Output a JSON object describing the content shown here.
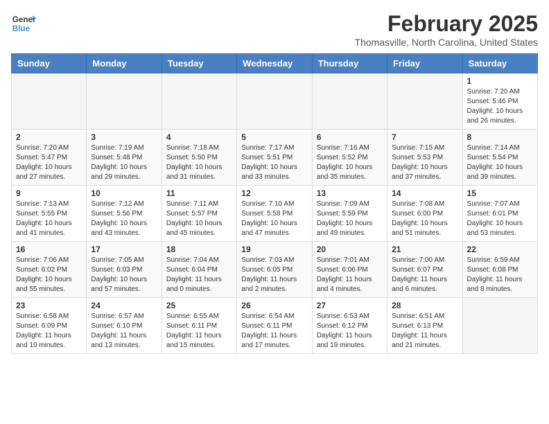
{
  "header": {
    "logo_line1": "General",
    "logo_line2": "Blue",
    "month_year": "February 2025",
    "location": "Thomasville, North Carolina, United States"
  },
  "days_of_week": [
    "Sunday",
    "Monday",
    "Tuesday",
    "Wednesday",
    "Thursday",
    "Friday",
    "Saturday"
  ],
  "weeks": [
    [
      {
        "day": "",
        "info": ""
      },
      {
        "day": "",
        "info": ""
      },
      {
        "day": "",
        "info": ""
      },
      {
        "day": "",
        "info": ""
      },
      {
        "day": "",
        "info": ""
      },
      {
        "day": "",
        "info": ""
      },
      {
        "day": "1",
        "info": "Sunrise: 7:20 AM\nSunset: 5:46 PM\nDaylight: 10 hours and 26 minutes."
      }
    ],
    [
      {
        "day": "2",
        "info": "Sunrise: 7:20 AM\nSunset: 5:47 PM\nDaylight: 10 hours and 27 minutes."
      },
      {
        "day": "3",
        "info": "Sunrise: 7:19 AM\nSunset: 5:48 PM\nDaylight: 10 hours and 29 minutes."
      },
      {
        "day": "4",
        "info": "Sunrise: 7:18 AM\nSunset: 5:50 PM\nDaylight: 10 hours and 31 minutes."
      },
      {
        "day": "5",
        "info": "Sunrise: 7:17 AM\nSunset: 5:51 PM\nDaylight: 10 hours and 33 minutes."
      },
      {
        "day": "6",
        "info": "Sunrise: 7:16 AM\nSunset: 5:52 PM\nDaylight: 10 hours and 35 minutes."
      },
      {
        "day": "7",
        "info": "Sunrise: 7:15 AM\nSunset: 5:53 PM\nDaylight: 10 hours and 37 minutes."
      },
      {
        "day": "8",
        "info": "Sunrise: 7:14 AM\nSunset: 5:54 PM\nDaylight: 10 hours and 39 minutes."
      }
    ],
    [
      {
        "day": "9",
        "info": "Sunrise: 7:13 AM\nSunset: 5:55 PM\nDaylight: 10 hours and 41 minutes."
      },
      {
        "day": "10",
        "info": "Sunrise: 7:12 AM\nSunset: 5:56 PM\nDaylight: 10 hours and 43 minutes."
      },
      {
        "day": "11",
        "info": "Sunrise: 7:11 AM\nSunset: 5:57 PM\nDaylight: 10 hours and 45 minutes."
      },
      {
        "day": "12",
        "info": "Sunrise: 7:10 AM\nSunset: 5:58 PM\nDaylight: 10 hours and 47 minutes."
      },
      {
        "day": "13",
        "info": "Sunrise: 7:09 AM\nSunset: 5:59 PM\nDaylight: 10 hours and 49 minutes."
      },
      {
        "day": "14",
        "info": "Sunrise: 7:08 AM\nSunset: 6:00 PM\nDaylight: 10 hours and 51 minutes."
      },
      {
        "day": "15",
        "info": "Sunrise: 7:07 AM\nSunset: 6:01 PM\nDaylight: 10 hours and 53 minutes."
      }
    ],
    [
      {
        "day": "16",
        "info": "Sunrise: 7:06 AM\nSunset: 6:02 PM\nDaylight: 10 hours and 55 minutes."
      },
      {
        "day": "17",
        "info": "Sunrise: 7:05 AM\nSunset: 6:03 PM\nDaylight: 10 hours and 57 minutes."
      },
      {
        "day": "18",
        "info": "Sunrise: 7:04 AM\nSunset: 6:04 PM\nDaylight: 11 hours and 0 minutes."
      },
      {
        "day": "19",
        "info": "Sunrise: 7:03 AM\nSunset: 6:05 PM\nDaylight: 11 hours and 2 minutes."
      },
      {
        "day": "20",
        "info": "Sunrise: 7:01 AM\nSunset: 6:06 PM\nDaylight: 11 hours and 4 minutes."
      },
      {
        "day": "21",
        "info": "Sunrise: 7:00 AM\nSunset: 6:07 PM\nDaylight: 11 hours and 6 minutes."
      },
      {
        "day": "22",
        "info": "Sunrise: 6:59 AM\nSunset: 6:08 PM\nDaylight: 11 hours and 8 minutes."
      }
    ],
    [
      {
        "day": "23",
        "info": "Sunrise: 6:58 AM\nSunset: 6:09 PM\nDaylight: 11 hours and 10 minutes."
      },
      {
        "day": "24",
        "info": "Sunrise: 6:57 AM\nSunset: 6:10 PM\nDaylight: 11 hours and 13 minutes."
      },
      {
        "day": "25",
        "info": "Sunrise: 6:55 AM\nSunset: 6:11 PM\nDaylight: 11 hours and 15 minutes."
      },
      {
        "day": "26",
        "info": "Sunrise: 6:54 AM\nSunset: 6:11 PM\nDaylight: 11 hours and 17 minutes."
      },
      {
        "day": "27",
        "info": "Sunrise: 6:53 AM\nSunset: 6:12 PM\nDaylight: 11 hours and 19 minutes."
      },
      {
        "day": "28",
        "info": "Sunrise: 6:51 AM\nSunset: 6:13 PM\nDaylight: 11 hours and 21 minutes."
      },
      {
        "day": "",
        "info": ""
      }
    ]
  ]
}
